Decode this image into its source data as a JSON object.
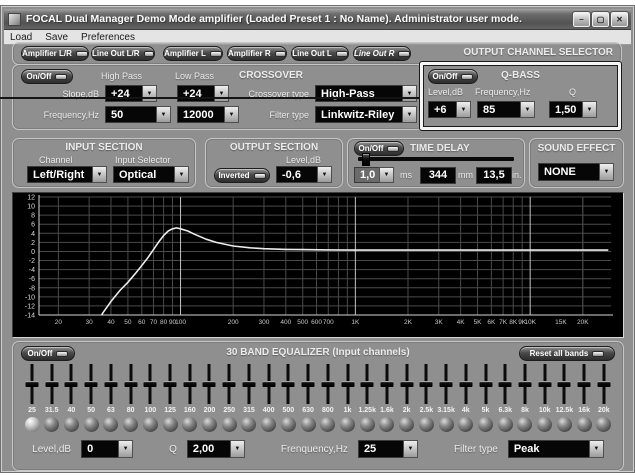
{
  "window": {
    "title": "FOCAL Dual Manager Demo Mode amplifier (Loaded Preset 1 : No Name).  Administrator user mode.",
    "minimize": "–",
    "maximize": "▢",
    "close": "✕"
  },
  "menu": {
    "items": [
      "Load",
      "Save",
      "Preferences"
    ]
  },
  "output_selector": {
    "title": "OUTPUT CHANNEL SELECTOR",
    "channels": [
      "Amplifier L/R",
      "Line Out L/R",
      "Amplifier L",
      "Amplifier R",
      "Line Out L",
      "Line Out R"
    ]
  },
  "crossover": {
    "on_off": "On/Off",
    "title": "CROSSOVER",
    "high_pass_label": "High Pass",
    "low_pass_label": "Low Pass",
    "slope_label": "Slope,dB",
    "slope_high": "+24",
    "slope_low": "+24",
    "frequency_label": "Frequency,Hz",
    "frequency_high": "50",
    "frequency_low": "12000",
    "crossover_type_label": "Crossover type",
    "crossover_type": "High-Pass",
    "filter_type_label": "Filter type",
    "filter_type": "Linkwitz-Riley"
  },
  "qbass": {
    "on_off": "On/Off",
    "title": "Q-BASS",
    "level_label": "Level,dB",
    "level": "+6",
    "frequency_label": "Frequency,Hz",
    "frequency": "85",
    "q_label": "Q",
    "q": "1,50"
  },
  "input_section": {
    "title": "INPUT SECTION",
    "channel_label": "Channel",
    "channel": "Left/Right",
    "input_selector_label": "Input Selector",
    "input_selector": "Optical"
  },
  "output_section": {
    "title": "OUTPUT SECTION",
    "level_label": "Level,dB",
    "inverted_label": "Inverted",
    "level": "-0,6"
  },
  "time_delay": {
    "on_off": "On/Off",
    "title": "TIME DELAY",
    "ms_value": "1,0",
    "ms_unit": "ms",
    "mm_value": "344",
    "mm_unit": "mm",
    "in_value": "13,5",
    "in_unit": "in."
  },
  "sound_effect": {
    "title": "SOUND EFFECT",
    "value": "NONE"
  },
  "equalizer": {
    "on_off": "On/Off",
    "title": "30 BAND EQUALIZER (Input channels)",
    "reset_label": "Reset all bands",
    "bands": [
      "25",
      "31.5",
      "40",
      "50",
      "63",
      "80",
      "100",
      "125",
      "160",
      "200",
      "250",
      "315",
      "400",
      "500",
      "630",
      "800",
      "1k",
      "1.25k",
      "1.6k",
      "2k",
      "2.5k",
      "3.15k",
      "4k",
      "5k",
      "6.3k",
      "8k",
      "10k",
      "12.5k",
      "16k",
      "20k"
    ],
    "selected_band": "25",
    "all_band_levels_db": 0
  },
  "eq_controls": {
    "level_label": "Level,dB",
    "level": "0",
    "q_label": "Q",
    "q": "2,00",
    "frequency_label": "Frenquency,Hz",
    "frequency": "25",
    "filter_type_label": "Filter type",
    "filter_type": "Peak"
  },
  "chart_data": {
    "type": "line",
    "title": "",
    "x_scale": "log",
    "x_range": [
      20,
      20000
    ],
    "y_range": [
      -14,
      12
    ],
    "y_ticks": [
      12,
      10,
      8,
      6,
      4,
      2,
      0,
      -2,
      -4,
      -6,
      -8,
      -10,
      -12,
      -14
    ],
    "x_tick_values": [
      20,
      30,
      40,
      50,
      60,
      70,
      80,
      90,
      100,
      200,
      300,
      400,
      500,
      600,
      700,
      1000,
      2000,
      3000,
      4000,
      5000,
      6000,
      7000,
      8000,
      9000,
      10000,
      15000,
      20000
    ],
    "x_tick_labels": [
      "20",
      "30",
      "40",
      "50",
      "60",
      "70",
      "80",
      "90",
      "100",
      "200",
      "300",
      "400",
      "500",
      "600",
      "700",
      "1K",
      "2K",
      "3K",
      "4K",
      "5K",
      "6K",
      "7K",
      "8K",
      "9K",
      "10K",
      "15K",
      "20K"
    ],
    "decade_lines": [
      100,
      1000,
      10000
    ],
    "grid": true,
    "series": [
      {
        "name": "frequency-response",
        "points": [
          [
            33,
            -16
          ],
          [
            36,
            -13.5
          ],
          [
            40,
            -11
          ],
          [
            45,
            -8.6
          ],
          [
            50,
            -6.8
          ],
          [
            55,
            -4.9
          ],
          [
            60,
            -3.1
          ],
          [
            65,
            -1.4
          ],
          [
            70,
            0.4
          ],
          [
            75,
            2.1
          ],
          [
            80,
            3.5
          ],
          [
            85,
            4.5
          ],
          [
            90,
            5.0
          ],
          [
            95,
            5.2
          ],
          [
            100,
            5.0
          ],
          [
            110,
            4.5
          ],
          [
            120,
            3.8
          ],
          [
            140,
            2.7
          ],
          [
            160,
            2.0
          ],
          [
            200,
            1.2
          ],
          [
            250,
            0.8
          ],
          [
            300,
            0.6
          ],
          [
            400,
            0.45
          ],
          [
            500,
            0.4
          ],
          [
            700,
            0.35
          ],
          [
            1000,
            0.3
          ],
          [
            2000,
            0.3
          ],
          [
            5000,
            0.3
          ],
          [
            10000,
            0.3
          ],
          [
            20000,
            0.3
          ],
          [
            28000,
            0.3
          ]
        ]
      }
    ]
  }
}
